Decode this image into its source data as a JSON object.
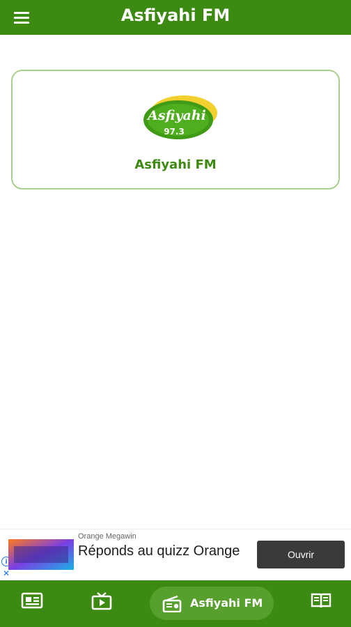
{
  "app_bar": {
    "title": "Asfiyahi FM",
    "menu_icon": "menu-icon"
  },
  "station": {
    "name": "Asfiyahi FM",
    "logo_text": "Asfiyahi",
    "logo_frequency": "97.3"
  },
  "ad": {
    "advertiser": "Orange Megawin",
    "headline": "Réponds au quizz Orange",
    "cta_label": "Ouvrir",
    "info_icon": "info-icon",
    "close_icon": "close-icon"
  },
  "bottom_nav": {
    "items": [
      {
        "icon": "news-icon"
      },
      {
        "icon": "tv-icon"
      },
      {
        "icon": "radio-icon",
        "label": "Asfiyahi FM",
        "active": true
      },
      {
        "icon": "book-icon"
      }
    ]
  },
  "colors": {
    "primary": "#3c8a12",
    "active_pill": "#57a02d",
    "card_border": "#a9cf8f",
    "ad_button": "#3a3a3a"
  }
}
